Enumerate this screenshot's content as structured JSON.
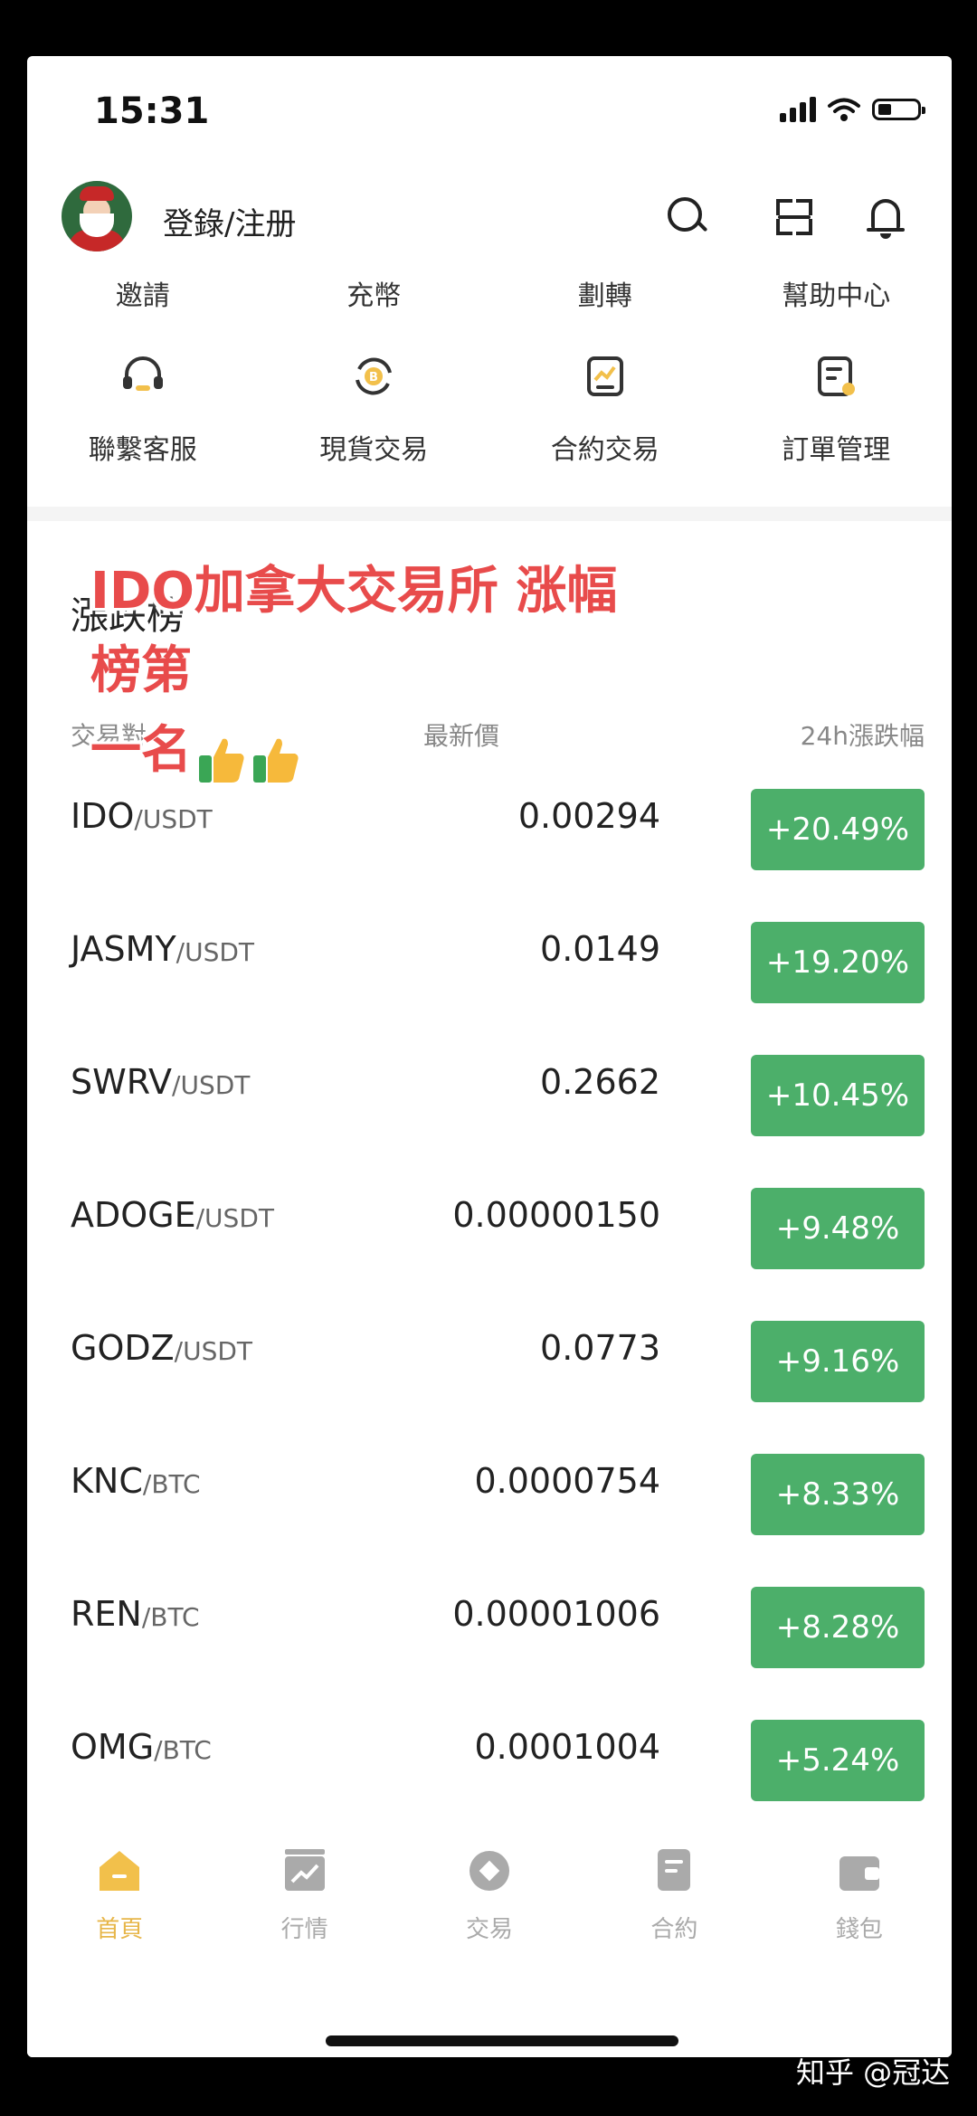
{
  "status_bar": {
    "time": "15:31"
  },
  "header": {
    "login_label": "登錄/注册"
  },
  "quick_actions": [
    {
      "label": "邀請"
    },
    {
      "label": "充幣"
    },
    {
      "label": "劃轉"
    },
    {
      "label": "幫助中心"
    }
  ],
  "shortcuts": [
    {
      "label": "聯繫客服",
      "icon": "headset-icon"
    },
    {
      "label": "現貨交易",
      "icon": "spot-trade-icon"
    },
    {
      "label": "合約交易",
      "icon": "contract-trade-icon"
    },
    {
      "label": "訂單管理",
      "icon": "order-management-icon"
    }
  ],
  "overlay": {
    "line1": "IDO加拿大交易所 涨幅榜第",
    "line2": "一名"
  },
  "gainers": {
    "title": "漲跌榜",
    "columns": {
      "pair": "交易對",
      "price": "最新價",
      "change": "24h漲跌幅"
    },
    "rows": [
      {
        "base": "IDO",
        "quote": "/USDT",
        "price": "0.00294",
        "change": "+20.49%"
      },
      {
        "base": "JASMY",
        "quote": "/USDT",
        "price": "0.0149",
        "change": "+19.20%"
      },
      {
        "base": "SWRV",
        "quote": "/USDT",
        "price": "0.2662",
        "change": "+10.45%"
      },
      {
        "base": "ADOGE",
        "quote": "/USDT",
        "price": "0.00000150",
        "change": "+9.48%"
      },
      {
        "base": "GODZ",
        "quote": "/USDT",
        "price": "0.0773",
        "change": "+9.16%"
      },
      {
        "base": "KNC",
        "quote": "/BTC",
        "price": "0.0000754",
        "change": "+8.33%"
      },
      {
        "base": "REN",
        "quote": "/BTC",
        "price": "0.00001006",
        "change": "+8.28%"
      },
      {
        "base": "OMG",
        "quote": "/BTC",
        "price": "0.0001004",
        "change": "+5.24%"
      }
    ]
  },
  "tabbar": {
    "tabs": [
      {
        "label": "首頁",
        "icon": "home-icon",
        "active": true
      },
      {
        "label": "行情",
        "icon": "market-chart-icon",
        "active": false
      },
      {
        "label": "交易",
        "icon": "trade-icon",
        "active": false
      },
      {
        "label": "合約",
        "icon": "contract-icon",
        "active": false
      },
      {
        "label": "錢包",
        "icon": "wallet-icon",
        "active": false
      }
    ]
  },
  "watermark": "知乎 @冠达",
  "colors": {
    "green": "#4caf6a",
    "overlay_red": "#e84b4b",
    "active_tab": "#e7b64a"
  }
}
